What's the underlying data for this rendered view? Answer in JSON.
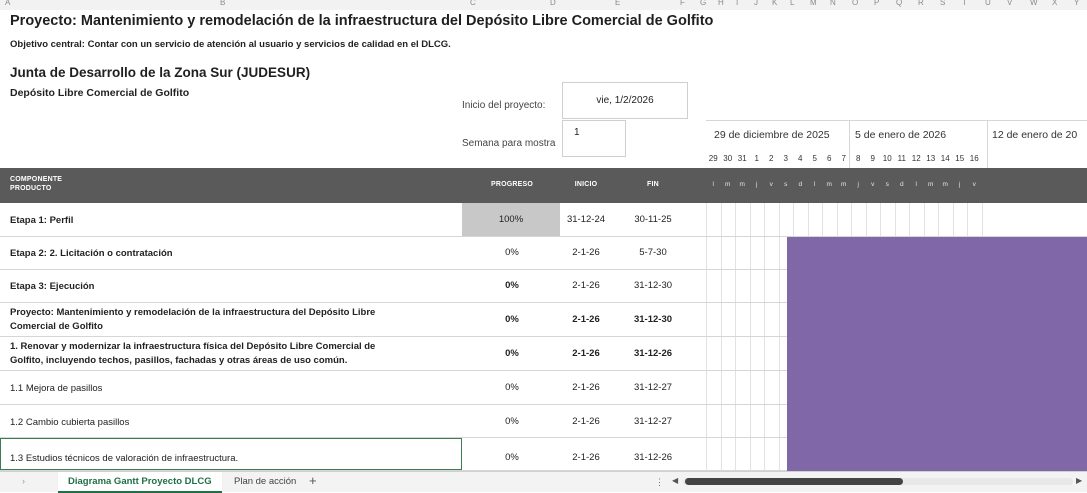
{
  "column_letters": [
    "A",
    "B",
    "C",
    "D",
    "E",
    "F",
    "G",
    "H",
    "I",
    "J",
    "K",
    "L",
    "M",
    "N",
    "O",
    "P",
    "Q",
    "R",
    "S",
    "T",
    "U",
    "V",
    "W",
    "X",
    "Y"
  ],
  "project": {
    "title": "Proyecto: Mantenimiento y remodelación de la infraestructura del Depósito Libre Comercial de Golfito",
    "objective": "Objetivo central: Contar con un servicio de atención al usuario y servicios de calidad en el DLCG.",
    "organization": "Junta de Desarrollo de la Zona Sur (JUDESUR)",
    "department": "Depósito Libre Comercial de Golfito"
  },
  "controls": {
    "start_label": "Inicio del proyecto:",
    "start_value": "vie, 1/2/2026",
    "week_label": "Semana para mostra",
    "week_value": "1"
  },
  "calendar": {
    "weeks": [
      "29 de diciembre de 2025",
      "5 de enero de 2026",
      "12 de enero de 20"
    ],
    "days": [
      "29",
      "30",
      "31",
      "1",
      "2",
      "3",
      "4",
      "5",
      "6",
      "7",
      "8",
      "9",
      "10",
      "11",
      "12",
      "13",
      "14",
      "15",
      "16"
    ],
    "dow": [
      "l",
      "m",
      "m",
      "j",
      "v",
      "s",
      "d",
      "l",
      "m",
      "m",
      "j",
      "v",
      "s",
      "d",
      "l",
      "m",
      "m",
      "j",
      "v"
    ]
  },
  "table": {
    "headers": {
      "component_line1": "COMPONENTE",
      "component_line2": "PRODUCTO",
      "progress": "PROGRESO",
      "start": "INICIO",
      "end": "FIN"
    },
    "rows": [
      {
        "label_line1": "Etapa 1: Perfil",
        "label_line2": "",
        "progress": "100%",
        "start": "31-12-24",
        "end": "30-11-25"
      },
      {
        "label_line1": "Etapa 2: 2. Licitación o contratación",
        "label_line2": "",
        "progress": "0%",
        "start": "2-1-26",
        "end": "5-7-30"
      },
      {
        "label_line1": "Etapa 3: Ejecución",
        "label_line2": "",
        "progress": "0%",
        "start": "2-1-26",
        "end": "31-12-30"
      },
      {
        "label_line1": "Proyecto: Mantenimiento y remodelación de la infraestructura del Depósito Libre",
        "label_line2": "Comercial de Golfito",
        "progress": "0%",
        "start": "2-1-26",
        "end": "31-12-30"
      },
      {
        "label_line1": "1. Renovar y modernizar la infraestructura física del Depósito Libre Comercial de",
        "label_line2": "Golfito, incluyendo techos, pasillos, fachadas y otras áreas de uso común.",
        "progress": "0%",
        "start": "2-1-26",
        "end": "31-12-26"
      },
      {
        "label_line1": "1.1 Mejora de pasillos",
        "label_line2": "",
        "progress": "0%",
        "start": "2-1-26",
        "end": "31-12-27"
      },
      {
        "label_line1": "1.2 Cambio cubierta pasillos",
        "label_line2": "",
        "progress": "0%",
        "start": "2-1-26",
        "end": "31-12-27"
      },
      {
        "label_line1": "1.3 Estudios técnicos de valoración de infraestructura.",
        "label_line2": "",
        "progress": "0%",
        "start": "2-1-26",
        "end": "31-12-26"
      }
    ]
  },
  "sheet_tabs": {
    "active": "Diagrama Gantt Proyecto DLCG",
    "other": "Plan de acción",
    "add": "+"
  },
  "colors": {
    "header_bg": "#5a5a5a",
    "gantt_bar": "#7f67a8",
    "progress_full_bg": "#c8c8c8"
  }
}
